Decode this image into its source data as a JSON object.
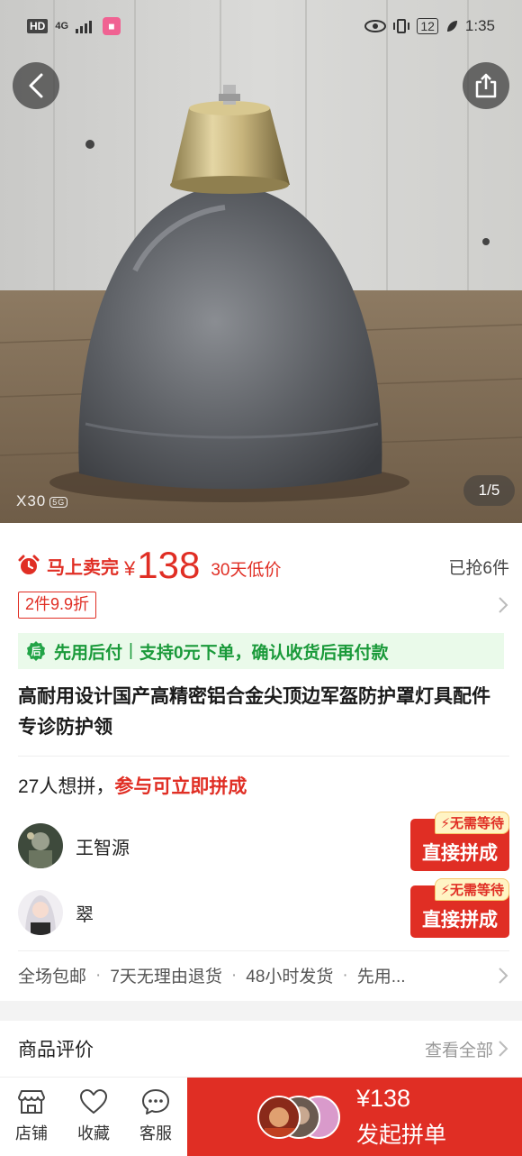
{
  "status_bar": {
    "left_hd": "HD",
    "left_net": "4G",
    "battery": "12",
    "time": "1:35"
  },
  "gallery": {
    "watermark": "X30",
    "watermark_badge": "5G",
    "page_indicator": "1/5"
  },
  "price_block": {
    "sellout_label": "马上卖完",
    "currency": "¥",
    "price": "138",
    "low_price_tag": "30天低价",
    "sold_count": "已抢6件",
    "coupon": "2件9.9折"
  },
  "pay_after": {
    "label": "先用后付",
    "separator": "|",
    "text": "支持0元下单，确认收货后再付款"
  },
  "product_title": "高耐用设计国产高精密铝合金尖顶边军盔防护罩灯具配件专诊防护领",
  "group_buy": {
    "count_text": "27人想拼，",
    "highlight_text": "参与可立即拼成",
    "members": [
      {
        "name": "王智源",
        "badge": "⚡无需等待",
        "button": "直接拼成"
      },
      {
        "name": "翠",
        "badge": "⚡无需等待",
        "button": "直接拼成"
      }
    ]
  },
  "services": {
    "items": [
      "全场包邮",
      "7天无理由退货",
      "48小时发货",
      "先用..."
    ]
  },
  "reviews": {
    "title": "商品评价",
    "view_all": "查看全部"
  },
  "bottom_bar": {
    "store": "店铺",
    "favorite": "收藏",
    "service": "客服",
    "launch_price": "¥138",
    "launch_label": "发起拼单"
  },
  "colors": {
    "accent": "#e02e24",
    "pay_after_green": "#1a9a3a"
  }
}
